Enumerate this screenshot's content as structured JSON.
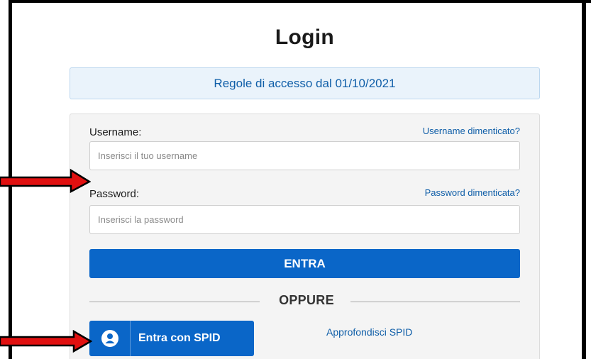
{
  "page": {
    "title": "Login",
    "notice": "Regole di accesso dal 01/10/2021"
  },
  "form": {
    "username": {
      "label": "Username:",
      "placeholder": "Inserisci il tuo username",
      "forgot_link": "Username dimenticato?"
    },
    "password": {
      "label": "Password:",
      "placeholder": "Inserisci la password",
      "forgot_link": "Password dimenticata?"
    },
    "submit_label": "ENTRA",
    "divider_text": "OPPURE"
  },
  "spid": {
    "button_label": "Entra con SPID",
    "info_link": "Approfondisci SPID",
    "icon": "user-icon"
  },
  "annotations": {
    "arrow_icon": "right-arrow-icon",
    "arrow_color": "#e01010"
  },
  "colors": {
    "primary": "#0a66c8",
    "link": "#0f5ea8",
    "notice_bg": "#eaf3fb",
    "panel_bg": "#f4f4f4"
  }
}
